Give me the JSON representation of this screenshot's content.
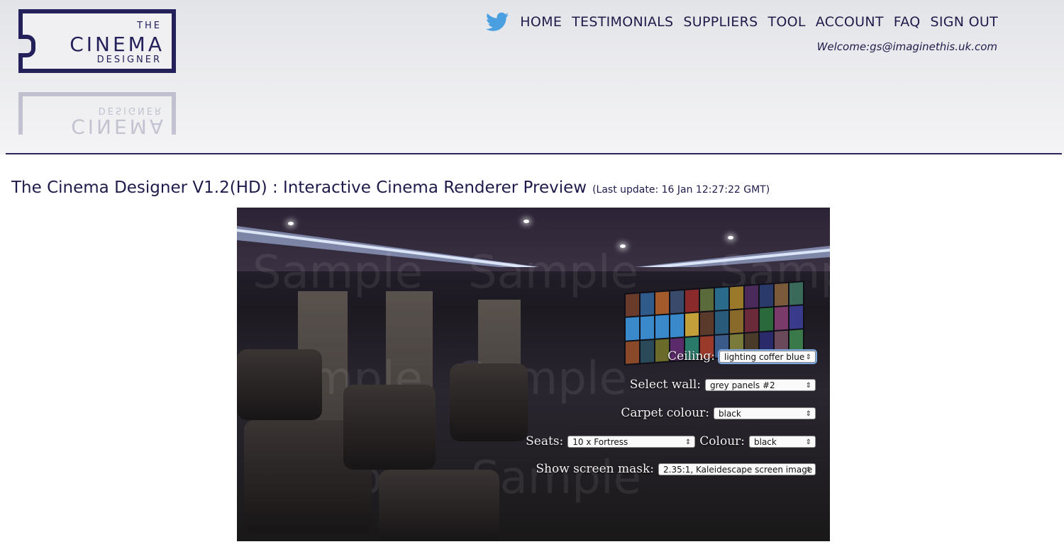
{
  "logo": {
    "line1": "THE",
    "line2": "CINEMA",
    "line3": "DESIGNER"
  },
  "nav": {
    "twitter_icon": "twitter-bird-icon",
    "items": [
      "HOME",
      "TESTIMONIALS",
      "SUPPLIERS",
      "TOOL",
      "ACCOUNT",
      "FAQ",
      "SIGN OUT"
    ]
  },
  "welcome": "Welcome:gs@imaginethis.uk.com",
  "page": {
    "title": "The Cinema Designer V1.2(HD) : Interactive Cinema Renderer Preview",
    "last_update": "(Last update: 16 Jan 12:27:22 GMT)"
  },
  "render": {
    "watermark": "Sample"
  },
  "controls": {
    "ceiling": {
      "label": "Ceiling:",
      "value": "lighting coffer blue"
    },
    "wall": {
      "label": "Select wall:",
      "value": "grey panels #2"
    },
    "carpet": {
      "label": "Carpet colour:",
      "value": "black"
    },
    "seats": {
      "label": "Seats:",
      "value": "10 x Fortress"
    },
    "seat_colour": {
      "label": "Colour:",
      "value": "black"
    },
    "screen_mask": {
      "label": "Show screen mask:",
      "value": "2.35:1, Kaleidescape screen image"
    }
  },
  "colors": {
    "brand": "#24205a",
    "accent_light": "#9fc0ff",
    "twitter": "#4a9fe0"
  }
}
